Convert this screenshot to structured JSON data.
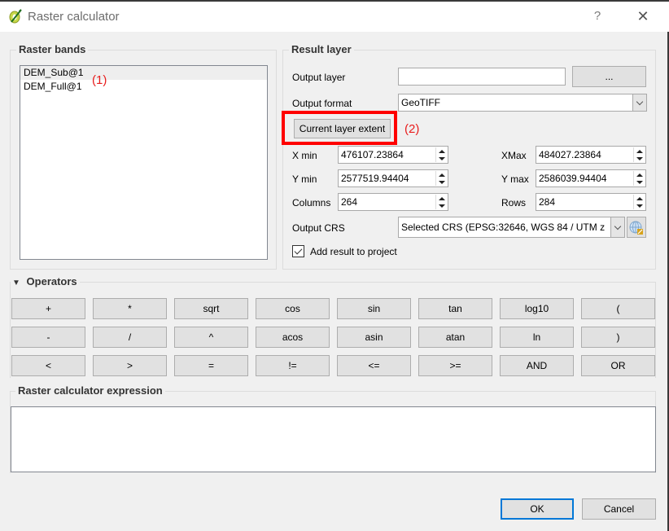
{
  "window": {
    "title": "Raster calculator",
    "help_label": "?",
    "close_label": "✕"
  },
  "raster_bands": {
    "title": "Raster bands",
    "items": [
      {
        "label": "DEM_Sub@1",
        "selected": true
      },
      {
        "label": "DEM_Full@1",
        "selected": false
      }
    ],
    "annotation": "(1)"
  },
  "result_layer": {
    "title": "Result layer",
    "output_layer_label": "Output layer",
    "output_layer_value": "",
    "browse_label": "...",
    "output_format_label": "Output format",
    "output_format_value": "GeoTIFF",
    "current_extent_label": "Current layer extent",
    "annotation": "(2)",
    "highlight_color": "#ff0000",
    "xmin_label": "X min",
    "xmin_value": "476107.23864",
    "xmax_label": "XMax",
    "xmax_value": "484027.23864",
    "ymin_label": "Y min",
    "ymin_value": "2577519.94404",
    "ymax_label": "Y max",
    "ymax_value": "2586039.94404",
    "columns_label": "Columns",
    "columns_value": "264",
    "rows_label": "Rows",
    "rows_value": "284",
    "output_crs_label": "Output CRS",
    "output_crs_value": "Selected CRS (EPSG:32646, WGS 84 / UTM z",
    "crs_icon": "crs-selector-icon",
    "add_result_label": "Add result to project",
    "add_result_checked": true
  },
  "operators": {
    "title": "Operators",
    "rows": [
      [
        "+",
        "*",
        "sqrt",
        "cos",
        "sin",
        "tan",
        "log10",
        "("
      ],
      [
        "-",
        "/",
        "^",
        "acos",
        "asin",
        "atan",
        "ln",
        ")"
      ],
      [
        "<",
        ">",
        "=",
        "!=",
        "<=",
        ">=",
        "AND",
        "OR"
      ]
    ]
  },
  "expression": {
    "title": "Raster calculator expression",
    "value": ""
  },
  "footer": {
    "ok_label": "OK",
    "cancel_label": "Cancel"
  }
}
